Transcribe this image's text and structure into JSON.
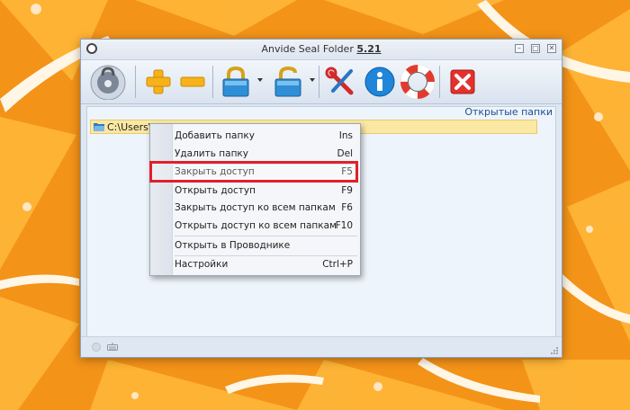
{
  "window": {
    "title_prefix": "Anvide Seal Folder",
    "version": "5.21",
    "minimize_glyph": "–",
    "maximize_glyph": "□",
    "close_glyph": "✕"
  },
  "toolbar": {
    "items": [
      {
        "name": "lock-disc-icon"
      },
      {
        "name": "add-folder-icon"
      },
      {
        "name": "remove-folder-icon"
      },
      {
        "name": "close-access-icon"
      },
      {
        "name": "open-access-icon"
      },
      {
        "name": "settings-tools-icon"
      },
      {
        "name": "info-icon"
      },
      {
        "name": "help-lifebuoy-icon"
      },
      {
        "name": "exit-icon"
      }
    ]
  },
  "content": {
    "open_folders_label": "Открытые папки",
    "folder_path": "C:\\Users\\"
  },
  "context_menu": {
    "items": [
      {
        "label": "Добавить папку",
        "shortcut": "Ins"
      },
      {
        "label": "Удалить папку",
        "shortcut": "Del"
      },
      {
        "label": "Закрыть доступ",
        "shortcut": "F5"
      },
      {
        "label": "Открыть доступ",
        "shortcut": "F9"
      },
      {
        "label": "Закрыть доступ ко всем папкам",
        "shortcut": "F6"
      },
      {
        "label": "Открыть доступ ко всем папкам",
        "shortcut": "F10"
      },
      {
        "label": "Открыть в Проводнике",
        "shortcut": ""
      },
      {
        "label": "Настройки",
        "shortcut": "Ctrl+P"
      }
    ]
  },
  "colors": {
    "highlight": "#e0202c",
    "folder_row": "#fbe8a4",
    "accent_link": "#1d4f91"
  }
}
